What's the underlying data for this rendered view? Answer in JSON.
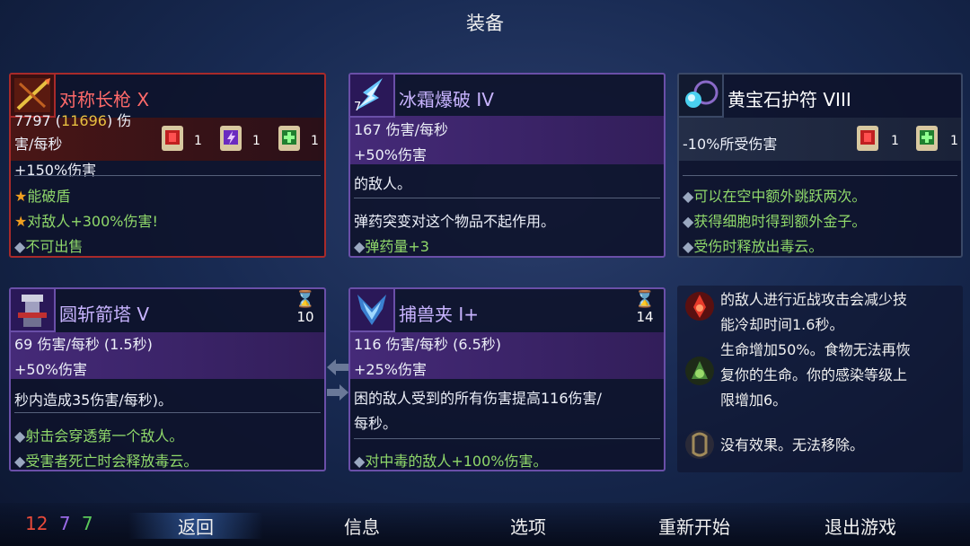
{
  "header": {
    "title": "装备"
  },
  "weapon1": {
    "name": "对称长枪",
    "rank": "X",
    "dps": "7797",
    "dps_crit": "11696",
    "dps_unit_a": "伤",
    "dps_unit_b": "害/每秒",
    "scroll_counts": [
      "1",
      "1",
      "1"
    ],
    "bonus": "+150%伤害",
    "affix1": "能破盾",
    "affix2": "对敌人+300%伤害!",
    "affix3": "不可出售"
  },
  "skill1": {
    "name": "冰霜爆破",
    "rank": "IV",
    "level": "7",
    "dps": "167 伤害/每秒",
    "bonus": "+50%伤害",
    "desc": "的敌人。",
    "note": "弹药突变对这个物品不起作用。",
    "affix1": "弹药量+3"
  },
  "amulet": {
    "name": "黄宝石护符",
    "rank": "VIII",
    "stat": "-10%所受伤害",
    "scroll_counts": [
      "1",
      "1"
    ],
    "affix1": "可以在空中额外跳跃两次。",
    "affix2": "获得细胞时得到额外金子。",
    "affix3": "受伤时释放出毒云。"
  },
  "skill2": {
    "name": "圆斩箭塔",
    "rank": "V",
    "cooldown": "10",
    "dps": "69 伤害/每秒 (1.5秒)",
    "bonus": "+50%伤害",
    "desc": "秒内造成35伤害/每秒)。",
    "affix1": "射击会穿透第一个敌人。",
    "affix2": "受害者死亡时会释放毒云。"
  },
  "skill3": {
    "name": "捕兽夹",
    "rank": "I+",
    "cooldown": "14",
    "dps": "116 伤害/每秒 (6.5秒)",
    "bonus": "+25%伤害",
    "desc1": "困的敌人受到的所有伤害提高116伤害/",
    "desc2": "每秒。",
    "affix1": "对中毒的敌人+100%伤害。"
  },
  "mutations": [
    {
      "icon": "combo-mutation-icon",
      "line1": "的敌人进行近战攻击会减少技",
      "line2": "能冷却时间1.6秒。",
      "line3": ""
    },
    {
      "icon": "extended-healing-mutation-icon",
      "line1": "生命增加50%。食物无法再恢",
      "line2": "复你的生命。你的感染等级上",
      "line3": "限增加6。"
    },
    {
      "icon": "empty-mutation-icon",
      "line1": "没有效果。无法移除。",
      "line2": "",
      "line3": ""
    }
  ],
  "stats": {
    "brutality": "12",
    "tactics": "7",
    "survival": "7"
  },
  "nav": {
    "back": "返回",
    "info": "信息",
    "options": "选项",
    "restart": "重新开始",
    "quit": "退出游戏"
  },
  "colors": {
    "brutality": "#e84a3a",
    "tactics": "#9a6ae8",
    "survival": "#5ac85a",
    "weapon_border": "#a82a2a",
    "skill_border": "#6a4fa8",
    "affix_green": "#8fd86a"
  }
}
